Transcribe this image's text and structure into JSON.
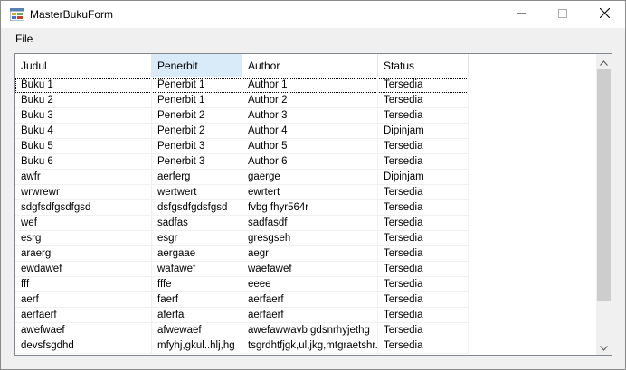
{
  "window": {
    "title": "MasterBukuForm"
  },
  "menu": {
    "file_label": "File"
  },
  "grid": {
    "columns": [
      "Judul",
      "Penerbit",
      "Author",
      "Status"
    ],
    "rows": [
      [
        "Buku 1",
        "Penerbit 1",
        "Author 1",
        "Tersedia"
      ],
      [
        "Buku 2",
        "Penerbit 1",
        "Author 2",
        "Tersedia"
      ],
      [
        "Buku 3",
        "Penerbit 2",
        "Author 3",
        "Tersedia"
      ],
      [
        "Buku 4",
        "Penerbit 2",
        "Author 4",
        "Dipinjam"
      ],
      [
        "Buku 5",
        "Penerbit 3",
        "Author 5",
        "Tersedia"
      ],
      [
        "Buku 6",
        "Penerbit 3",
        "Author 6",
        "Tersedia"
      ],
      [
        "awfr",
        "aerferg",
        "gaerge",
        "Dipinjam"
      ],
      [
        "wrwrewr",
        "wertwert",
        "ewrtert",
        "Tersedia"
      ],
      [
        "sdgfsdfgsdfgsd",
        "dsfgsdfgdsfgsd",
        "fvbg fhyr564r",
        "Tersedia"
      ],
      [
        "wef",
        "sadfas",
        "sadfasdf",
        "Tersedia"
      ],
      [
        "esrg",
        "esgr",
        "gresgseh",
        "Tersedia"
      ],
      [
        "araerg",
        "aergaae",
        "aegr",
        "Tersedia"
      ],
      [
        "ewdawef",
        "wafawef",
        "waefawef",
        "Tersedia"
      ],
      [
        "fff",
        "fffe",
        "eeee",
        "Tersedia"
      ],
      [
        "aerf",
        "faerf",
        "aerfaerf",
        "Tersedia"
      ],
      [
        "aerfaerf",
        "aferfa",
        "aerfaerf",
        "Tersedia"
      ],
      [
        "awefwaef",
        "afwewaef",
        "awefawwavb gdsnrhyjethg",
        "Tersedia"
      ],
      [
        "devsfsgdhd",
        "mfyhj,gkul..hlj,hg",
        "tsgrdhtfjgk,ul,jkg,mtgraetshr...",
        "Tersedia"
      ]
    ]
  },
  "icons": {
    "app": "form-app-icon",
    "minimize": "minimize-icon",
    "maximize": "maximize-icon",
    "close": "close-icon",
    "scroll_up": "chevron-up-icon",
    "scroll_down": "chevron-down-icon"
  }
}
